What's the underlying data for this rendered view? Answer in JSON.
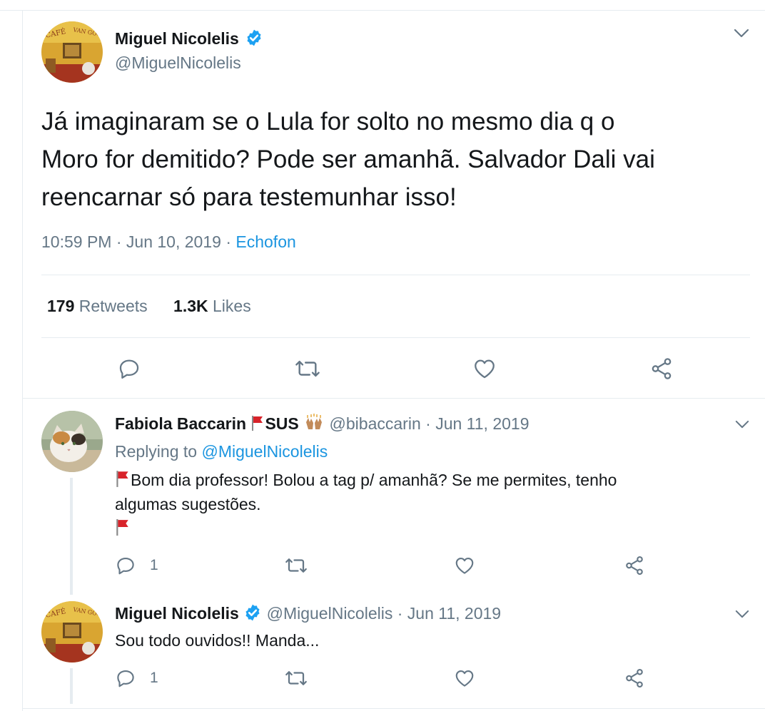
{
  "main_tweet": {
    "author_name": "Miguel Nicolelis",
    "author_handle": "@MiguelNicolelis",
    "avatar_icon": "cafe-van-gogh-avatar",
    "text_line1": "Já imaginaram se o Lula for solto no mesmo dia q o",
    "text_line2": "Moro for demitido? Pode ser amanhã. Salvador Dali vai",
    "text_line3": "reencarnar só para testemunhar isso!",
    "time": "10:59 PM",
    "date": "Jun 10, 2019",
    "sep": "·",
    "source": "Echofon",
    "retweets_count": "179",
    "retweets_label": "Retweets",
    "likes_count": "1.3K",
    "likes_label": "Likes"
  },
  "reply1": {
    "author_name": "Fabiola Baccarin",
    "name_suffix": "SUS",
    "handle": "@bibaccarin",
    "sep": "·",
    "date": "Jun 11, 2019",
    "replying_prefix": "Replying to",
    "replying_to": "@MiguelNicolelis",
    "text_line1": "Bom dia professor! Bolou a tag p/ amanhã? Se me permites, tenho",
    "text_line2": "algumas sugestões.",
    "reply_count": "1",
    "avatar_icon": "cat-avatar"
  },
  "reply2": {
    "author_name": "Miguel Nicolelis",
    "handle": "@MiguelNicolelis",
    "sep": "·",
    "date": "Jun 11, 2019",
    "text": "Sou todo ouvidos!! Manda...",
    "reply_count": "1",
    "avatar_icon": "cafe-van-gogh-avatar"
  },
  "colors": {
    "text": "#14171a",
    "muted": "#657786",
    "link": "#1b95e0",
    "verified": "#1da1f2",
    "divider": "#e6ecf0",
    "flag": "#d8232a"
  }
}
